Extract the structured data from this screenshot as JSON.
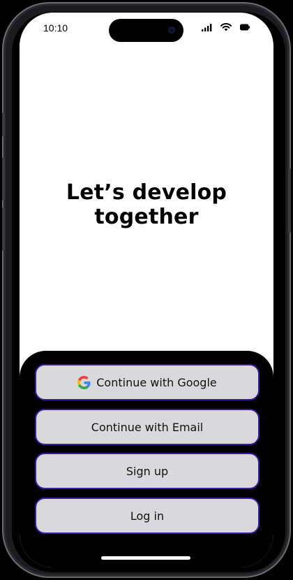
{
  "status_bar": {
    "time": "10:10",
    "icons": [
      "signal-icon",
      "wifi-icon",
      "battery-icon"
    ]
  },
  "hero": {
    "title": "Let’s develop together"
  },
  "auth": {
    "google_label": "Continue with Google",
    "email_label": "Continue with Email",
    "signup_label": "Sign up",
    "login_label": "Log in"
  },
  "colors": {
    "sheet_background": "#000000",
    "button_fill": "#d9d8da",
    "button_border": "#3b1f9e",
    "google_blue": "#4285F4",
    "google_red": "#EA4335",
    "google_yellow": "#FBBC05",
    "google_green": "#34A853"
  }
}
